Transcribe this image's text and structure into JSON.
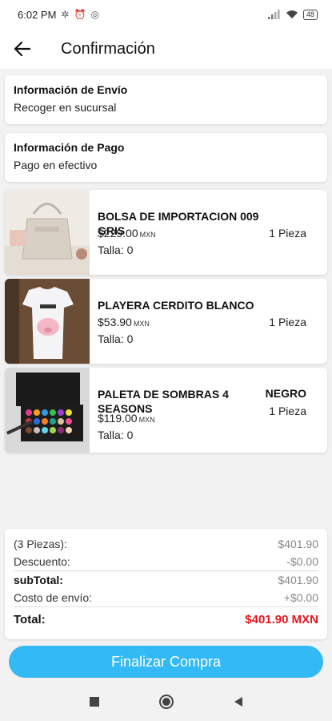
{
  "status_bar": {
    "time": "6:02 PM",
    "battery": "48"
  },
  "header": {
    "title": "Confirmación"
  },
  "shipping": {
    "title": "Información de Envío",
    "value": "Recoger en sucursal"
  },
  "payment": {
    "title": "Información de Pago",
    "value": "Pago en efectivo"
  },
  "products": [
    {
      "name": "BOLSA DE IMPORTACION 009 GRIS",
      "price": "$229.00",
      "currency": "MXN",
      "size": "Talla: 0",
      "qty": "1 Pieza",
      "variant": ""
    },
    {
      "name": "PLAYERA CERDITO  BLANCO",
      "price": "$53.90",
      "currency": "MXN",
      "size": "Talla: 0",
      "qty": "1 Pieza",
      "variant": ""
    },
    {
      "name": "PALETA DE SOMBRAS 4 SEASONS",
      "price": "$119.00",
      "currency": "MXN",
      "size": "Talla: 0",
      "qty": "1 Pieza",
      "variant": "NEGRO"
    }
  ],
  "summary": {
    "pieces_label": "(3 Piezas):",
    "pieces_value": "$401.90",
    "discount_label": "Descuento:",
    "discount_value": "-$0.00",
    "subtotal_label": "subTotal:",
    "subtotal_value": "$401.90",
    "shipping_label": "Costo de envío:",
    "shipping_value": "+$0.00",
    "total_label": "Total:",
    "total_value": "$401.90 MXN"
  },
  "actions": {
    "finalize": "Finalizar Compra"
  },
  "colors": {
    "accent": "#33b9f3",
    "total": "#e8141b"
  }
}
